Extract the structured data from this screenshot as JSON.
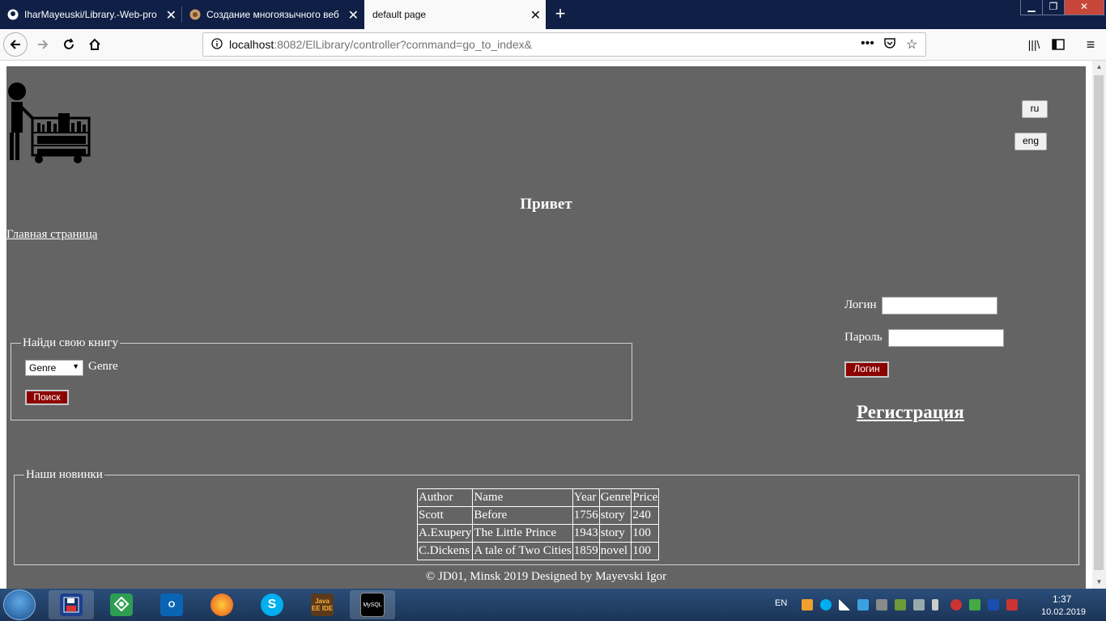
{
  "browser": {
    "tabs": [
      {
        "label": "IharMayeuski/Library.-Web-pro",
        "icon": "github-icon",
        "active": false
      },
      {
        "label": "Создание многоязычного веб",
        "icon": "site-icon",
        "active": false
      },
      {
        "label": "default page",
        "icon": "",
        "active": true
      }
    ],
    "url_host": "localhost",
    "url_rest": ":8082/ElLibrary/controller?command=go_to_index&"
  },
  "page": {
    "lang_ru": "ru",
    "lang_eng": "eng",
    "greeting": "Привет",
    "home_link": "Главная страница",
    "search": {
      "legend": "Найди свою книгу",
      "select_value": "Genre",
      "select_label": "Genre",
      "button": "Поиск"
    },
    "login": {
      "login_label": "Логин",
      "password_label": "Пароль",
      "button": "Логин",
      "register": "Регистрация"
    },
    "news": {
      "legend": "Наши новинки",
      "headers": [
        "Author",
        "Name",
        "Year",
        "Genre",
        "Price"
      ],
      "rows": [
        [
          "Scott",
          "Before",
          "1756",
          "story",
          "240"
        ],
        [
          "A.Exupery",
          "The Little Prince",
          "1943",
          "story",
          "100"
        ],
        [
          "C.Dickens",
          "A tale of Two Cities",
          "1859",
          "novel",
          "100"
        ]
      ]
    },
    "footer": "© JD01, Minsk 2019 Designed by Mayevski Igor"
  },
  "taskbar": {
    "apps": [
      "floppy-icon",
      "green-app-icon",
      "outlook-icon",
      "firefox-icon",
      "skype-icon",
      "java-ee-ide-icon",
      "mysql-console-icon"
    ],
    "java_label": "Java EE IDE",
    "mysql_label": "MySQL",
    "lang": "EN",
    "time": "1:37",
    "date": "10.02.2019"
  },
  "colors": {
    "page_bg": "#646464",
    "button_red": "#8b0000",
    "tabbar": "#0f1f45"
  }
}
